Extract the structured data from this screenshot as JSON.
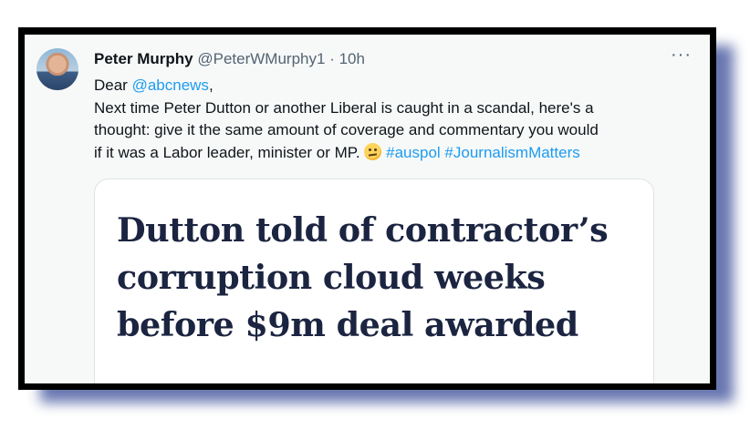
{
  "tweet": {
    "author_name": "Peter Murphy",
    "handle": "@PeterWMurphy1",
    "separator": "·",
    "time": "10h",
    "more_label": "···",
    "lines": {
      "l1_prefix": "Dear ",
      "l1_mention": "@abcnews",
      "l1_suffix": ",",
      "l2": "Next time Peter Dutton or another Liberal is caught in a scandal, here's a",
      "l3": "thought: give it the same amount of coverage and commentary you would",
      "l4_text": "if it was a Labor leader, minister or MP.",
      "emoji": "thinking-face",
      "hashtag1": "#auspol",
      "hashtag2": "#JournalismMatters"
    }
  },
  "card": {
    "headline_lines": [
      "Dutton told of contractor’s",
      "corruption cloud weeks",
      "before $9m deal awarded"
    ]
  },
  "colors": {
    "link": "#1d9bf0",
    "frame": "#000000",
    "shadow": "#4e5fa3",
    "headline": "#1b2440"
  }
}
